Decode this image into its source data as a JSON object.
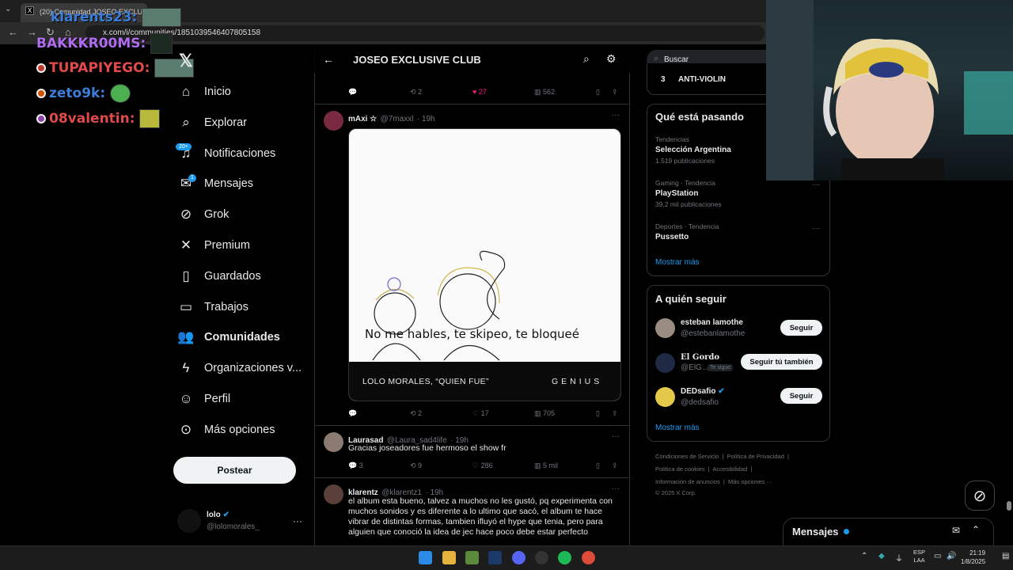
{
  "browser": {
    "tab_title": "(20) Comunidad JOSEO EXCLUS",
    "url": "x.com/i/communities/1851039546407805158"
  },
  "chat": [
    {
      "user": "klarents23:"
    },
    {
      "user": "BAKKKR00MS:"
    },
    {
      "user": "TUPAPIYEGO:"
    },
    {
      "user": "zeto9k:"
    },
    {
      "user": "08valentin:"
    }
  ],
  "nav": {
    "items": [
      {
        "label": "Inicio",
        "icon": "home-icon"
      },
      {
        "label": "Explorar",
        "icon": "search-icon"
      },
      {
        "label": "Notificaciones",
        "icon": "bell-icon",
        "badge": "20+"
      },
      {
        "label": "Mensajes",
        "icon": "mail-icon",
        "badge": "1"
      },
      {
        "label": "Grok",
        "icon": "grok-icon"
      },
      {
        "label": "Premium",
        "icon": "x-logo-icon"
      },
      {
        "label": "Guardados",
        "icon": "bookmark-icon"
      },
      {
        "label": "Trabajos",
        "icon": "briefcase-icon"
      },
      {
        "label": "Comunidades",
        "icon": "people-icon"
      },
      {
        "label": "Organizaciones v...",
        "icon": "lightning-icon"
      },
      {
        "label": "Perfil",
        "icon": "person-icon"
      },
      {
        "label": "Más opciones",
        "icon": "more-circle-icon"
      }
    ],
    "post_label": "Postear",
    "account": {
      "name": "lolo",
      "handle": "@lolomorales_"
    }
  },
  "column": {
    "title": "JOSEO EXCLUSIVE CLUB"
  },
  "posts": [
    {
      "reply": "",
      "retweet": "2",
      "like": "27",
      "views": "562"
    },
    {
      "name": "mAxi ☆",
      "handle": "@7maxxl",
      "time": "· 19h",
      "caption": "No me hables, te skipeo, te bloqueé",
      "card_left": "LOLO MORALES, “QUIEN FUE”",
      "card_right": "GENIUS",
      "reply": "",
      "retweet": "2",
      "like": "17",
      "views": "705"
    },
    {
      "name": "Laurasad",
      "handle": "@Laura_sad4life",
      "time": "· 19h",
      "text": "Gracias joseadores fue hermoso el show fr",
      "reply": "3",
      "retweet": "9",
      "like": "286",
      "views": "5 mil"
    },
    {
      "name": "klarentz",
      "handle": "@klarentz1",
      "time": "· 19h",
      "text": "el album esta bueno, talvez a muchos no les gustó, pq  experimenta con muchos sonidos y es diferente a lo ultimo que sacó, el album te hace vibrar de distintas formas, tambien ifluyó el hype que tenia, pero para alguien que conoció la idea de jec hace poco debe estar perfecto"
    }
  ],
  "right": {
    "search_placeholder": "Buscar",
    "top_item": {
      "rank": "3",
      "label": "ANTI-VIOLIN"
    },
    "trends_title": "Qué está pasando",
    "trends": [
      {
        "meta": "Tendencias",
        "name": "Selección Argentina",
        "count": "1.519 publicaciones"
      },
      {
        "meta": "Gaming · Tendencia",
        "name": "PlayStation",
        "count": "39,2 mil publicaciones"
      },
      {
        "meta": "Deportes · Tendencia",
        "name": "Pussetto",
        "count": ""
      }
    ],
    "show_more": "Mostrar más",
    "follow_title": "A quién seguir",
    "follow": [
      {
        "name": "esteban lamothe",
        "handle": "@estebanlamothe",
        "button": "Seguir",
        "tag": ""
      },
      {
        "name": "El Gordo",
        "handle": "@ElG...",
        "button": "Seguir tú también",
        "tag": "Te sigue"
      },
      {
        "name": "DEDsafio",
        "handle": "@dedsafio",
        "button": "Seguir",
        "tag": ""
      }
    ],
    "follow_more": "Mostrar más",
    "footer": {
      "line1a": "Condiciones de Servicio",
      "line1b": "Política de Privacidad",
      "line2a": "Política de cookies",
      "line2b": "Accesibilidad",
      "line3a": "Información de anuncios",
      "line3b": "Más opciones ···",
      "line4": "© 2025 X Corp."
    },
    "messages_label": "Mensajes"
  },
  "taskbar": {
    "lang1": "ESP",
    "lang2": "LAA",
    "time": "21:19",
    "date": "1/8/2025"
  }
}
